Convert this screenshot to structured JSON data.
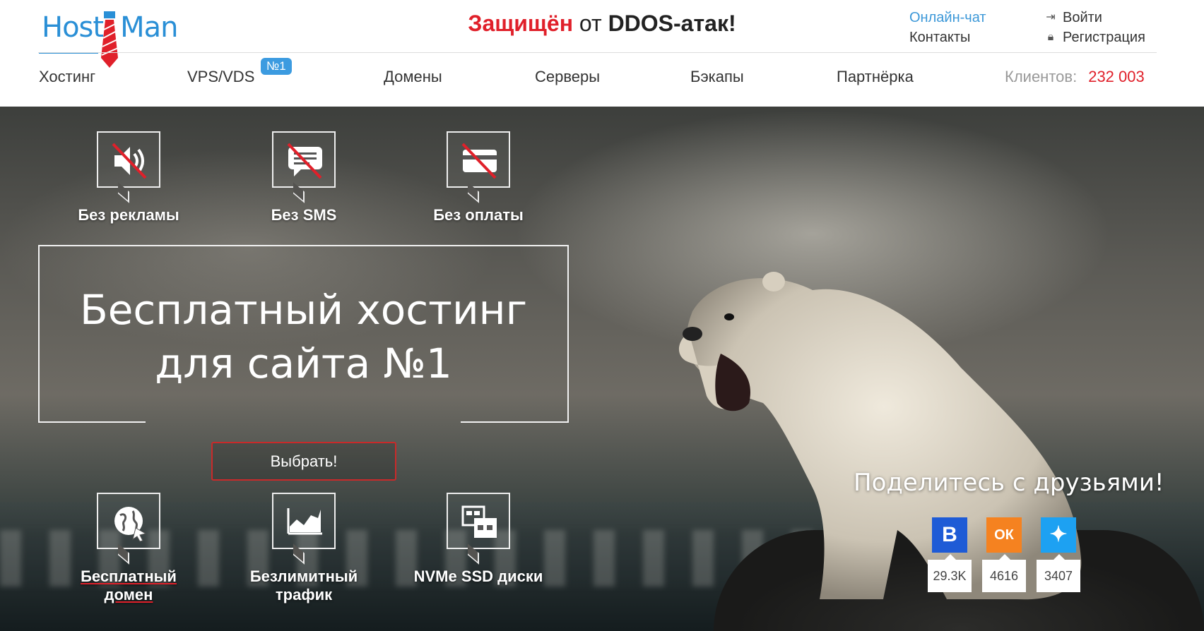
{
  "logo": {
    "part1": "Host",
    "part2": "Man"
  },
  "header": {
    "slogan_red": "Защищён",
    "slogan_mid": "от",
    "slogan_end": "DDOS-атак!",
    "chat": "Онлайн-чат",
    "contacts": "Контакты",
    "login": "Войти",
    "register": "Регистрация"
  },
  "nav": {
    "items": [
      "Хостинг",
      "VPS/VDS",
      "Домены",
      "Серверы",
      "Бэкапы",
      "Партнёрка"
    ],
    "badge": "№1",
    "clients_label": "Клиентов:",
    "clients_count": "232 003"
  },
  "features_top": [
    {
      "label": "Без рекламы",
      "icon": "no-ads-icon"
    },
    {
      "label": "Без SMS",
      "icon": "no-sms-icon"
    },
    {
      "label": "Без оплаты",
      "icon": "no-payment-icon"
    }
  ],
  "hero": {
    "headline_line1": "Бесплатный хостинг",
    "headline_line2": "для сайта №1",
    "cta": "Выбрать!"
  },
  "features_bottom": [
    {
      "label": "Бесплатный домен",
      "icon": "globe-icon"
    },
    {
      "label": "Безлимитный трафик",
      "icon": "traffic-chart-icon"
    },
    {
      "label": "NVMe SSD диски",
      "icon": "ssd-disk-icon"
    }
  ],
  "share": {
    "title": "Поделитесь с друзьями!",
    "networks": [
      {
        "name": "vk",
        "glyph": "В",
        "count": "29.3K",
        "color": "#1e5bd6"
      },
      {
        "name": "ok",
        "glyph": "ОК",
        "count": "4616",
        "color": "#f58220"
      },
      {
        "name": "twitter",
        "glyph": "✦",
        "count": "3407",
        "color": "#1da1f2"
      }
    ]
  },
  "colors": {
    "brand": "#2a8fd6",
    "accent_red": "#e0202a",
    "badge": "#3c9be0"
  }
}
